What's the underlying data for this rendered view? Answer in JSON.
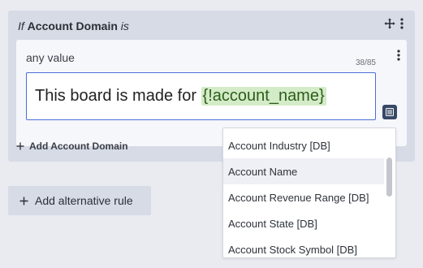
{
  "rule": {
    "prefix": "If",
    "field": "Account Domain",
    "operator": "is",
    "icons": [
      "move-icon",
      "kebab-menu-icon"
    ]
  },
  "value_card": {
    "label": "any value",
    "char_count": "38/85",
    "input_text_prefix": "This board is made for ",
    "input_token": "{!account_name}"
  },
  "add_domain_label": "Add Account Domain",
  "add_alternative_label": "Add alternative rule",
  "dropdown": {
    "items": [
      {
        "label": "Account Industry [DB]",
        "active": false
      },
      {
        "label": "Account Name",
        "active": true
      },
      {
        "label": "Account Revenue Range [DB]",
        "active": false
      },
      {
        "label": "Account State [DB]",
        "active": false
      },
      {
        "label": "Account Stock Symbol [DB]",
        "active": false
      }
    ]
  },
  "colors": {
    "panel": "#d6dbe6",
    "card": "#f6f7fb",
    "input_border": "#4b6fd6",
    "token_bg": "#d4ebc8",
    "insert_button": "#384866"
  }
}
